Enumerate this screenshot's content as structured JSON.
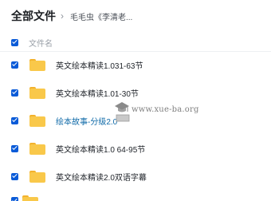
{
  "breadcrumb": {
    "root": "全部文件",
    "separator": "›",
    "current": "毛毛虫《李清老..."
  },
  "list_header": {
    "column_label": "文件名",
    "select_all_checked": true
  },
  "files": [
    {
      "name": "英文绘本精读1.031-63节",
      "checked": true,
      "type": "folder"
    },
    {
      "name": "英文绘本精读1.01-30节",
      "checked": true,
      "type": "folder"
    },
    {
      "name": "绘本故事-分级2.0",
      "checked": true,
      "type": "folder"
    },
    {
      "name": "英文绘本精读1.0 64-95节",
      "checked": true,
      "type": "folder"
    },
    {
      "name": "英文绘本精读2.0双语字幕",
      "checked": true,
      "type": "folder"
    }
  ],
  "watermark": {
    "text": "www.xue-ba.org"
  },
  "colors": {
    "accent": "#0a5bd8",
    "folder": "#f9c84a",
    "highlight_text": "#0f6aa8"
  }
}
